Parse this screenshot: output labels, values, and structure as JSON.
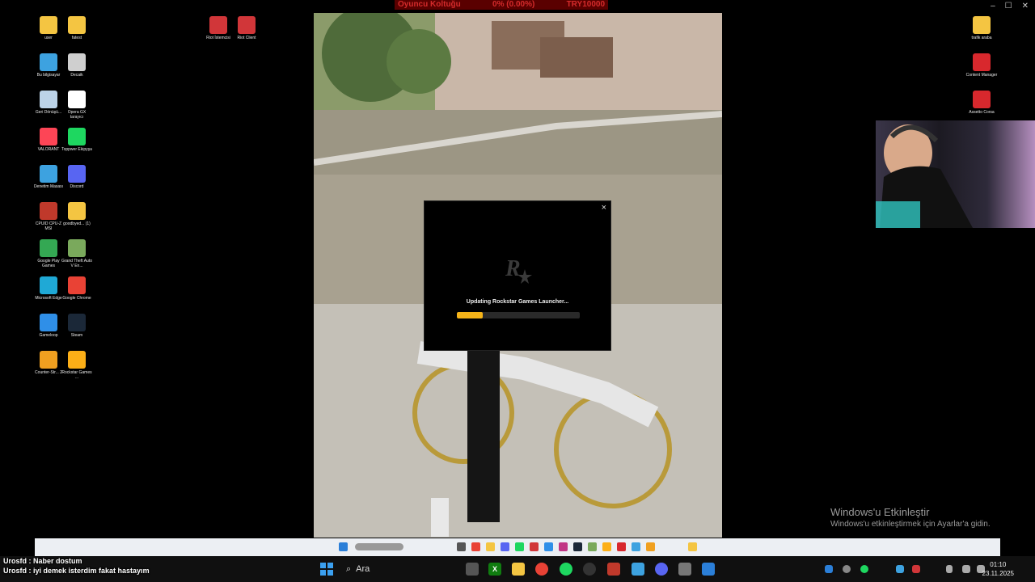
{
  "desktop_left": [
    {
      "label": "user",
      "icon": "folder-icon",
      "color": "#f4c542"
    },
    {
      "label": "fatest",
      "icon": "folder-icon",
      "color": "#f4c542"
    },
    {
      "label": "Bu bilgisayar",
      "icon": "computer-icon",
      "color": "#3da2e0"
    },
    {
      "label": "Decaik",
      "icon": "rabbit-icon",
      "color": "#cfcfcf"
    },
    {
      "label": "Geri Dönüşü...",
      "icon": "recycle-bin-icon",
      "color": "#bcd3e8"
    },
    {
      "label": "Opera GX tarayıcı",
      "icon": "file-icon",
      "color": "#ffffff"
    },
    {
      "label": "VALORANT",
      "icon": "valorant-icon",
      "color": "#fd4556"
    },
    {
      "label": "Toppwer Ekipyşa",
      "icon": "t-app-icon",
      "color": "#1ed760"
    },
    {
      "label": "Denetim Masası",
      "icon": "control-panel-icon",
      "color": "#3da2e0"
    },
    {
      "label": "Discord",
      "icon": "discord-icon",
      "color": "#5865f2"
    },
    {
      "label": "CPUID CPU-Z MSI",
      "icon": "cpuz-icon",
      "color": "#c0392b"
    },
    {
      "label": "goodbyed... (1)",
      "icon": "folder-icon",
      "color": "#f4c542"
    },
    {
      "label": "Google Play Games",
      "icon": "play-games-icon",
      "color": "#34a853"
    },
    {
      "label": "Grand Theft Auto V En...",
      "icon": "gta-icon",
      "color": "#7aa95c"
    },
    {
      "label": "Microsoft Edge",
      "icon": "edge-icon",
      "color": "#1fa9d6"
    },
    {
      "label": "Google Chrome",
      "icon": "chrome-icon",
      "color": "#e94235"
    },
    {
      "label": "Gameloop",
      "icon": "gameloop-icon",
      "color": "#2f8fe8"
    },
    {
      "label": "Steam",
      "icon": "steam-icon",
      "color": "#1b2838"
    },
    {
      "label": "Counter-Str... 2",
      "icon": "counter-strike-icon",
      "color": "#f0a020"
    },
    {
      "label": "Rockstar Games ...",
      "icon": "rockstar-icon",
      "color": "#fcaf17"
    }
  ],
  "desktop_top": [
    {
      "label": "Riot İstemcisi",
      "icon": "riot-icon",
      "color": "#d13639"
    },
    {
      "label": "Riot Client",
      "icon": "riot-icon",
      "color": "#d13639"
    }
  ],
  "desktop_right": [
    {
      "label": "trafik araba",
      "icon": "folder-icon",
      "color": "#f4c542"
    },
    {
      "label": "Content Manager",
      "icon": "content-manager-icon",
      "color": "#d8282d"
    },
    {
      "label": "Assetto Corsa",
      "icon": "assetto-corsa-icon",
      "color": "#d8282d"
    }
  ],
  "stream_overlay": {
    "name": "Oyuncu Koltuğu",
    "percent": "0% (0.00%)",
    "amount": "TRY10000"
  },
  "launcher": {
    "status": "Updating Rockstar Games Launcher...",
    "progress": 0.21,
    "close": "×",
    "accent": "#f6b418"
  },
  "activation": {
    "title": "Windows'u Etkinleştir",
    "subtitle": "Windows'u etkinleştirmek için Ayarlar'a gidin."
  },
  "chat": [
    {
      "user": "Urosfd",
      "sep": " : ",
      "text": "Naber dostum"
    },
    {
      "user": "Urosfd",
      "sep": " : ",
      "text": "iyi demek isterdim fakat hastayım"
    }
  ],
  "taskbar": {
    "search_label": "Ara",
    "time": "01:10",
    "date": "23.11.2025"
  }
}
